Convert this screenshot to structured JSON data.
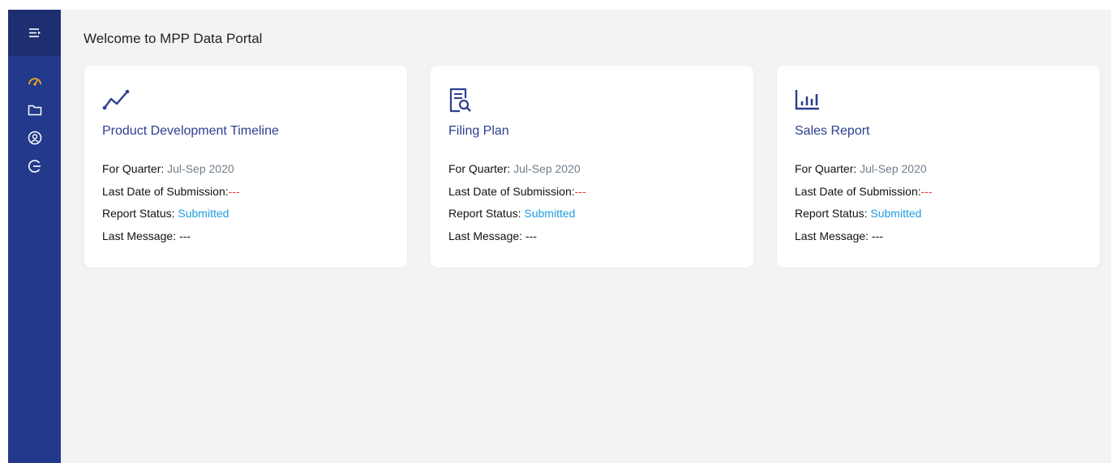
{
  "app": {
    "title": "Welcome to MPP Data Portal"
  },
  "colors": {
    "sidebar": "#233a8c",
    "sidebar_top": "#1d2f70",
    "accent_orange": "#f5a623",
    "title_blue": "#2d3f8f",
    "status_blue": "#1f9de0",
    "red": "#e53935"
  },
  "sidebar": {
    "toggle_icon": "menu-collapse-icon",
    "items": [
      {
        "icon": "dashboard-icon",
        "active": true
      },
      {
        "icon": "folder-icon",
        "active": false
      },
      {
        "icon": "user-icon",
        "active": false
      },
      {
        "icon": "logout-icon",
        "active": false
      }
    ]
  },
  "labels": {
    "quarter": "For Quarter:",
    "last_date": "Last Date of Submission:",
    "status": "Report Status:",
    "message": "Last Message:"
  },
  "cards": [
    {
      "icon": "trend-line-icon",
      "title": "Product Development Timeline",
      "quarter": "Jul-Sep 2020",
      "last_date": "---",
      "status": "Submitted",
      "message": "---"
    },
    {
      "icon": "document-search-icon",
      "title": "Filing Plan",
      "quarter": "Jul-Sep 2020",
      "last_date": "---",
      "status": "Submitted",
      "message": "---"
    },
    {
      "icon": "bar-chart-icon",
      "title": "Sales Report",
      "quarter": "Jul-Sep 2020",
      "last_date": "---",
      "status": "Submitted",
      "message": "---"
    }
  ]
}
